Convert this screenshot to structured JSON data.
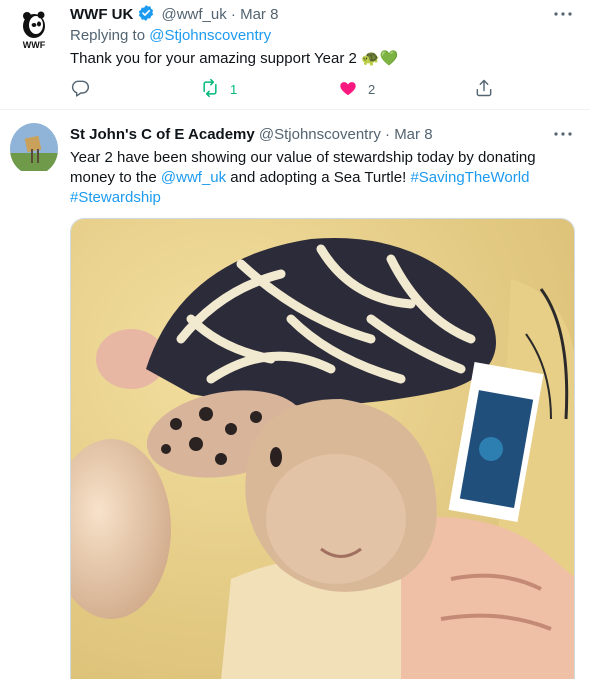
{
  "tweet1": {
    "display_name": "WWF UK",
    "handle": "@wwf_uk",
    "separator": "·",
    "date": "Mar 8",
    "reply_prefix": "Replying to",
    "reply_handle": "@Stjohnscoventry",
    "text": "Thank you for your amazing support Year 2",
    "emoji_turtle": "🐢",
    "emoji_heart": "💚",
    "retweets": "1",
    "likes": "2",
    "logo_text": "WWF"
  },
  "tweet2": {
    "display_name": "St John's C of E Academy",
    "handle": "@Stjohnscoventry",
    "separator": "·",
    "date": "Mar 8",
    "text_part1": "Year 2 have been showing our value of stewardship today by donating money to the ",
    "mention": "@wwf_uk",
    "text_part2": " and adopting a Sea Turtle! ",
    "hashtag1": "#SavingTheWorld",
    "hashtag2": "#Stewardship"
  },
  "colors": {
    "link": "#1d9bf0",
    "retweet_active": "#00ba7c",
    "like_active": "#f91880",
    "muted": "#536471"
  },
  "icons": [
    "verified-badge-icon",
    "more-icon",
    "reply-icon",
    "retweet-icon",
    "like-icon",
    "share-icon"
  ]
}
